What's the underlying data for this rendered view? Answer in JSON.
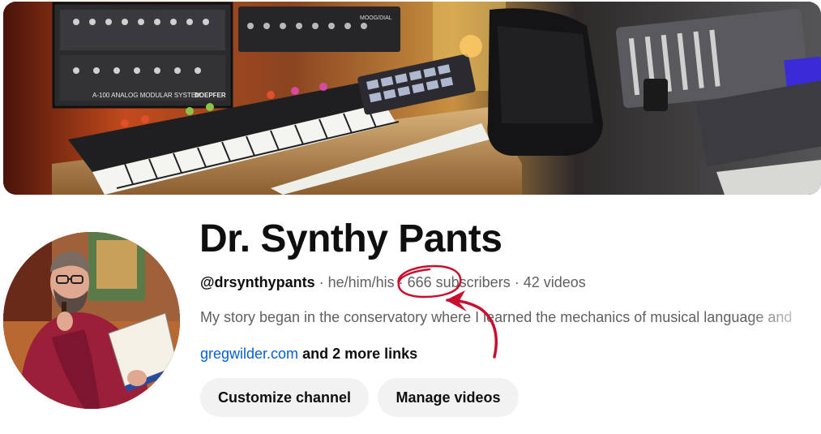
{
  "channel": {
    "name": "Dr. Synthy Pants",
    "handle": "@drsynthypants",
    "pronouns": "he/him/his",
    "subscribers": "666 subscribers",
    "videos": "42 videos",
    "description": "My story began in the conservatory where I learned the mechanics of musical language and",
    "link_primary": "gregwilder.com",
    "link_more": "and 2 more links"
  },
  "actions": {
    "customize_label": "Customize channel",
    "manage_label": "Manage videos"
  },
  "banner": {
    "module_brand": "DOEPFER",
    "module_label": "A-100 ANALOG MODULAR SYSTEM",
    "synth_brand": "MOOG/DIAL"
  },
  "colors": {
    "link": "#065fd4",
    "button_bg": "#f2f2f2",
    "annotation": "#c8102e",
    "meta_text": "#606060"
  }
}
